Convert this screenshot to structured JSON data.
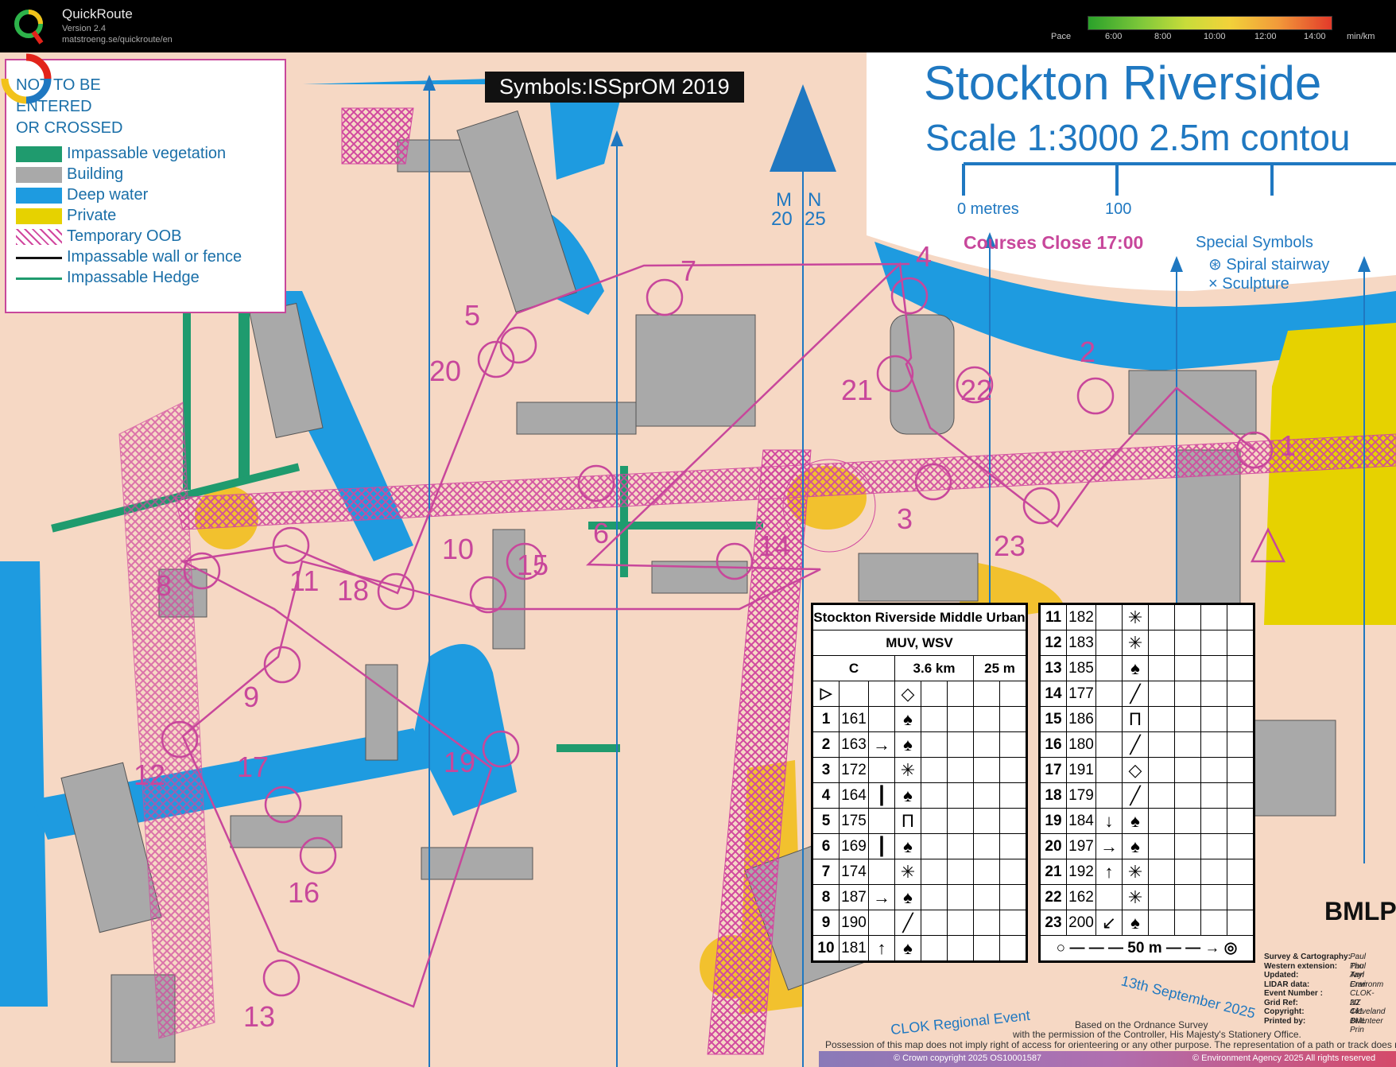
{
  "app": {
    "name": "QuickRoute",
    "version": "Version 2.4",
    "url": "matstroeng.se/quickroute/en",
    "pace_label": "Pace",
    "pace_ticks": [
      "6:00",
      "8:00",
      "10:00",
      "12:00",
      "14:00"
    ],
    "pace_unit": "min/km"
  },
  "legend": {
    "warning": "NOT TO BE\nENTERED\n OR CROSSED",
    "items": [
      {
        "label": "Impassable vegetation",
        "color": "#1f9b6e"
      },
      {
        "label": "Building",
        "color": "#a9a9a9"
      },
      {
        "label": "Deep water",
        "color": "#1e9be0"
      },
      {
        "label": "Private",
        "color": "#e6d200"
      },
      {
        "label": "Temporary  OOB",
        "color": "#d1489f"
      },
      {
        "label": "Impassable wall or fence",
        "color": "#111111"
      },
      {
        "label": "Impassable Hedge",
        "color": "#1f9b6e"
      }
    ]
  },
  "map": {
    "symbols_badge": "Symbols:ISSprOM 2019",
    "title": "Stockton Riverside",
    "scale": "Scale 1:3000   2.5m contou",
    "scale_bar_labels": [
      "0 metres",
      "100"
    ],
    "courses_close": "Courses Close 17:00",
    "special_symbols_title": "Special Symbols",
    "special_symbols": [
      "⊛ Spiral stairway",
      "× Sculpture"
    ],
    "north_labels": [
      "M",
      "N",
      "20",
      "25"
    ],
    "event": "CLOK Regional Event",
    "date": "13th September 2025",
    "os_notice": [
      "Based on the Ordnance Survey",
      "with the permission of the Controller, His Majesty's Stationery Office."
    ],
    "possession_notice": "Possession of this map does not imply right of access for orienteering or any other purpose. The representation of a path or track does not indicate",
    "crown_copyright": "© Crown copyright 2025 OS10001587",
    "ea_copyright": "© Environment Agency 2025 All rights reserved",
    "printer": "BMLPr",
    "credits": [
      {
        "k": "Survey & Cartography:",
        "v": "Paul Tho"
      },
      {
        "k": "Western extension:",
        "v": "Paul Tayl"
      },
      {
        "k": "Updated:",
        "v": "Ann Cran"
      },
      {
        "k": "LIDAR data:",
        "v": "Environm"
      },
      {
        "k": "Event Number :",
        "v": "CLOK-20"
      },
      {
        "k": "Grid Ref:",
        "v": "NZ 441 1"
      },
      {
        "k": "Copyright:",
        "v": "Cleveland Orienteer"
      },
      {
        "k": "Printed by:",
        "v": "BML Prin"
      }
    ],
    "controls": [
      "1",
      "2",
      "3",
      "4",
      "5",
      "6",
      "7",
      "8",
      "9",
      "10",
      "11",
      "12",
      "13",
      "14",
      "15",
      "16",
      "17",
      "18",
      "19",
      "20",
      "21",
      "22",
      "23"
    ]
  },
  "descriptions": {
    "event_title": "Stockton Riverside Middle Urban",
    "classes": "MUV, WSV",
    "course": "C",
    "length": "3.6 km",
    "climb": "25 m",
    "left_rows": [
      {
        "n": "1",
        "code": "161",
        "dir": "",
        "feat": "♠"
      },
      {
        "n": "2",
        "code": "163",
        "dir": "→",
        "feat": "♠"
      },
      {
        "n": "3",
        "code": "172",
        "dir": "",
        "feat": "✳"
      },
      {
        "n": "4",
        "code": "164",
        "dir": "┃",
        "feat": "♠"
      },
      {
        "n": "5",
        "code": "175",
        "dir": "",
        "feat": "Π"
      },
      {
        "n": "6",
        "code": "169",
        "dir": "┃",
        "feat": "♠"
      },
      {
        "n": "7",
        "code": "174",
        "dir": "",
        "feat": "✳"
      },
      {
        "n": "8",
        "code": "187",
        "dir": "→",
        "feat": "♠"
      },
      {
        "n": "9",
        "code": "190",
        "dir": "",
        "feat": "╱"
      },
      {
        "n": "10",
        "code": "181",
        "dir": "↑",
        "feat": "♠"
      }
    ],
    "right_rows": [
      {
        "n": "11",
        "code": "182",
        "dir": "",
        "feat": "✳"
      },
      {
        "n": "12",
        "code": "183",
        "dir": "",
        "feat": "✳"
      },
      {
        "n": "13",
        "code": "185",
        "dir": "",
        "feat": "♠"
      },
      {
        "n": "14",
        "code": "177",
        "dir": "",
        "feat": "╱"
      },
      {
        "n": "15",
        "code": "186",
        "dir": "",
        "feat": "Π"
      },
      {
        "n": "16",
        "code": "180",
        "dir": "",
        "feat": "╱"
      },
      {
        "n": "17",
        "code": "191",
        "dir": "",
        "feat": "◇"
      },
      {
        "n": "18",
        "code": "179",
        "dir": "",
        "feat": "╱"
      },
      {
        "n": "19",
        "code": "184",
        "dir": "↓",
        "feat": "♠"
      },
      {
        "n": "20",
        "code": "197",
        "dir": "→",
        "feat": "♠"
      },
      {
        "n": "21",
        "code": "192",
        "dir": "↑",
        "feat": "✳"
      },
      {
        "n": "22",
        "code": "162",
        "dir": "",
        "feat": "✳"
      },
      {
        "n": "23",
        "code": "200",
        "dir": "↙",
        "feat": "♠"
      }
    ],
    "finish_distance": "50 m"
  }
}
